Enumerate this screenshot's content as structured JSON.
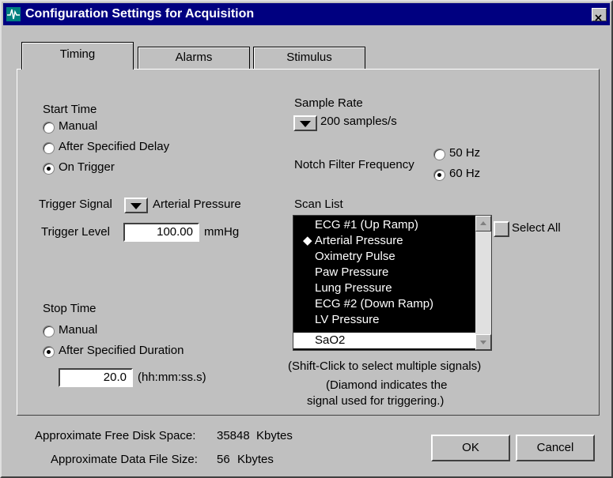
{
  "window": {
    "title": "Configuration Settings for Acquisition"
  },
  "tabs": [
    {
      "label": "Timing",
      "active": true
    },
    {
      "label": "Alarms",
      "active": false
    },
    {
      "label": "Stimulus",
      "active": false
    }
  ],
  "start_time": {
    "label": "Start Time",
    "options": [
      {
        "label": "Manual",
        "selected": false
      },
      {
        "label": "After Specified Delay",
        "selected": false
      },
      {
        "label": "On Trigger",
        "selected": true
      }
    ]
  },
  "trigger": {
    "signal_label": "Trigger Signal",
    "signal_value": "Arterial Pressure",
    "level_label": "Trigger Level",
    "level_value": "100.00",
    "level_unit": "mmHg"
  },
  "stop_time": {
    "label": "Stop Time",
    "options": [
      {
        "label": "Manual",
        "selected": false
      },
      {
        "label": "After Specified Duration",
        "selected": true
      }
    ],
    "duration_value": "20.0",
    "duration_unit": "(hh:mm:ss.s)"
  },
  "sample_rate": {
    "label": "Sample Rate",
    "value": "200 samples/s"
  },
  "notch_filter": {
    "label": "Notch Filter Frequency",
    "options": [
      {
        "label": "50 Hz",
        "selected": false
      },
      {
        "label": "60 Hz",
        "selected": true
      }
    ]
  },
  "scan_list": {
    "label": "Scan List",
    "items": [
      {
        "label": "ECG #1 (Up Ramp)",
        "selected": true
      },
      {
        "label": "Arterial Pressure",
        "selected": true,
        "diamond": "◆"
      },
      {
        "label": "Oximetry Pulse",
        "selected": true
      },
      {
        "label": "Paw Pressure",
        "selected": true
      },
      {
        "label": "Lung Pressure",
        "selected": true
      },
      {
        "label": "ECG #2 (Down Ramp)",
        "selected": true
      },
      {
        "label": "LV Pressure",
        "selected": true
      },
      {
        "label": "SaO2",
        "selected": false
      }
    ],
    "select_all_label": "Select All",
    "hint1": "(Shift-Click to select multiple signals)",
    "hint2": "(Diamond indicates the",
    "hint3": "signal used for triggering.)"
  },
  "footer": {
    "free_disk_label": "Approximate Free Disk Space:",
    "free_disk_value": "35848",
    "free_disk_unit": "Kbytes",
    "file_size_label": "Approximate Data File Size:",
    "file_size_value": "56",
    "file_size_unit": "Kbytes",
    "ok_label": "OK",
    "cancel_label": "Cancel"
  },
  "colors": {
    "titlebar": "#000080",
    "dialog": "#c0c0c0",
    "list_selected": "#000000"
  },
  "icons": {
    "app": "waveform-icon",
    "close": "close-icon",
    "dropdown": "dropdown-arrow-icon",
    "diamond": "diamond-icon"
  }
}
